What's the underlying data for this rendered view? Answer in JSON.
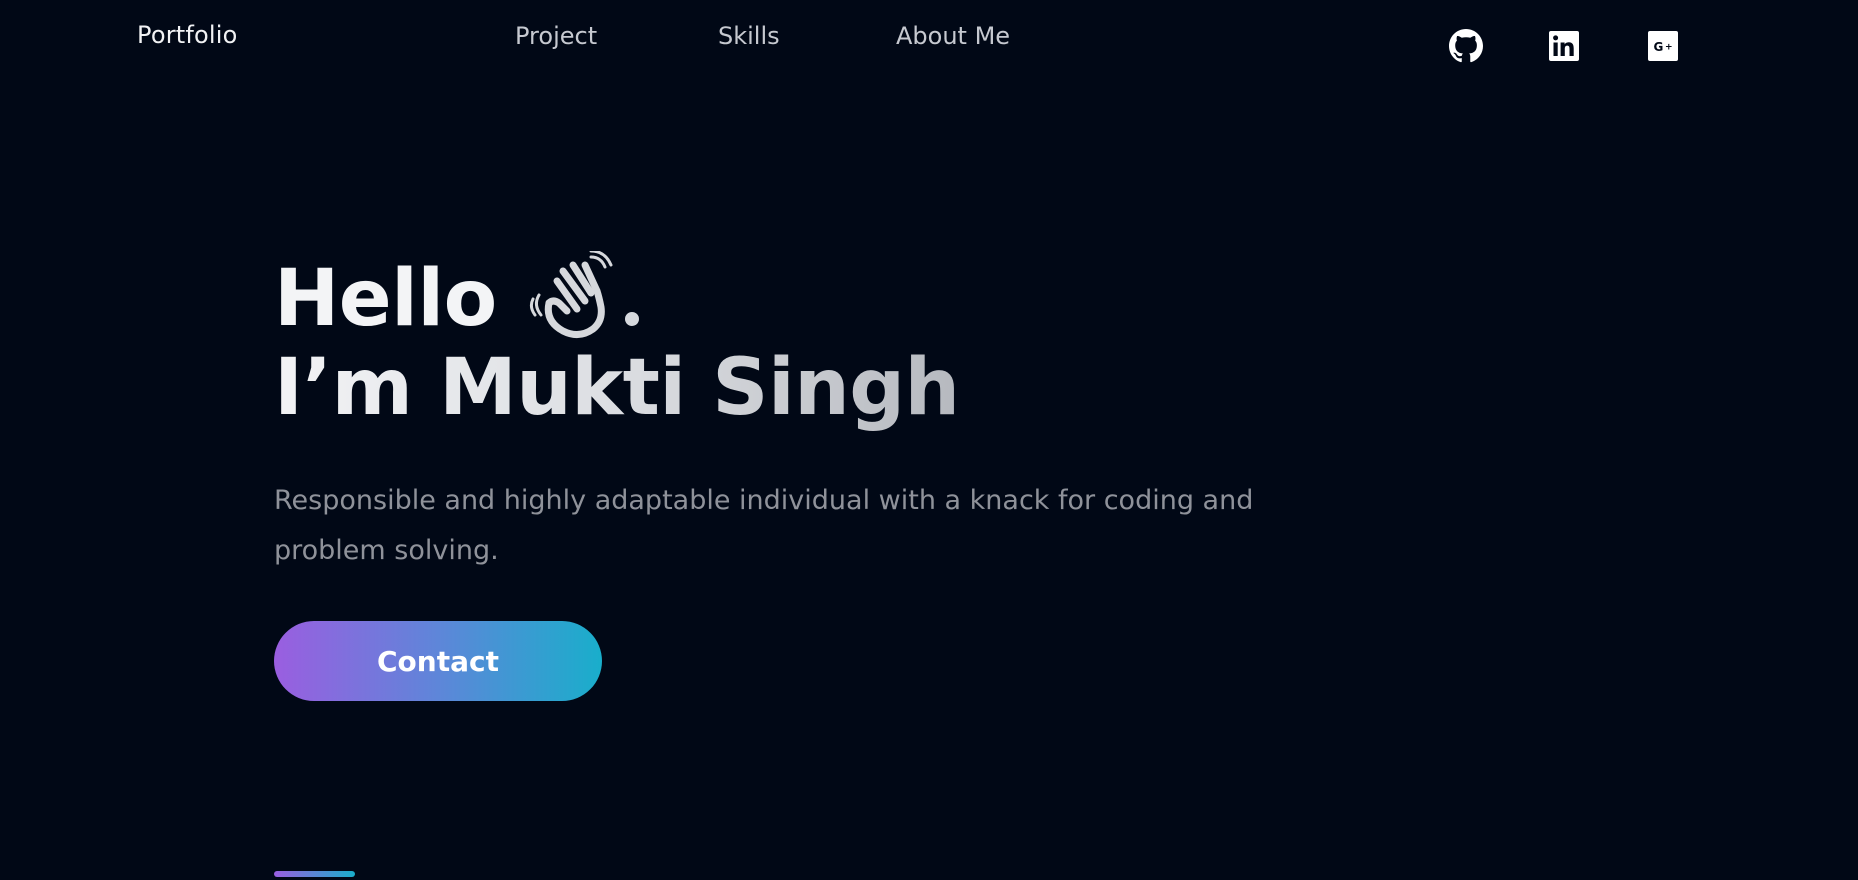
{
  "header": {
    "brand": "Portfolio",
    "nav": [
      "Project",
      "Skills",
      "About Me"
    ],
    "social": [
      {
        "name": "github",
        "icon": "github-icon"
      },
      {
        "name": "linkedin",
        "icon": "linkedin-icon"
      },
      {
        "name": "google-plus",
        "icon": "google-plus-icon"
      }
    ]
  },
  "hero": {
    "greeting": "Hello",
    "wave_icon": "waving-hand-icon",
    "name_line": "I’m Mukti Singh",
    "bio": "Responsible and highly adaptable individual with a knack for coding and problem solving.",
    "contact_label": "Contact"
  },
  "colors": {
    "background": "#010816",
    "gradient_start": "#9a5ee0",
    "gradient_end": "#19aecb",
    "text_primary": "#f3f4f6",
    "text_muted": "#8f929a",
    "nav_text": "#c6c9d0"
  }
}
